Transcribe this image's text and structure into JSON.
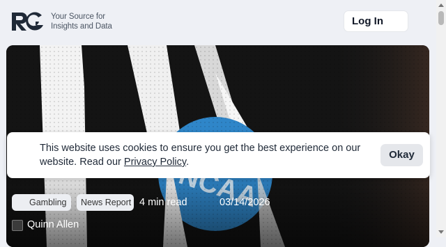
{
  "header": {
    "logo_icon": "rg-logo-icon",
    "tagline_line1": "Your Source for",
    "tagline_line2": "Insights and Data",
    "login_label": "Log In"
  },
  "article": {
    "image_icon": "referee-ncaa-photo-icon",
    "tags": [
      "Gambling",
      "News Report"
    ],
    "read_time": "4 min read",
    "date": "03/14/2026",
    "author": "Quinn Allen",
    "author_icon": "author-avatar-icon"
  },
  "cookie_banner": {
    "text_before": "This website uses cookies to ensure you get the best experience on our website. Read our ",
    "link_label": "Privacy Policy",
    "text_after": ".",
    "okay_label": "Okay"
  },
  "colors": {
    "background": "#eef0f5",
    "ncaa_blue": "#2f86c9",
    "banner_bg": "#ffffff",
    "button_bg": "#e5e7eb"
  }
}
